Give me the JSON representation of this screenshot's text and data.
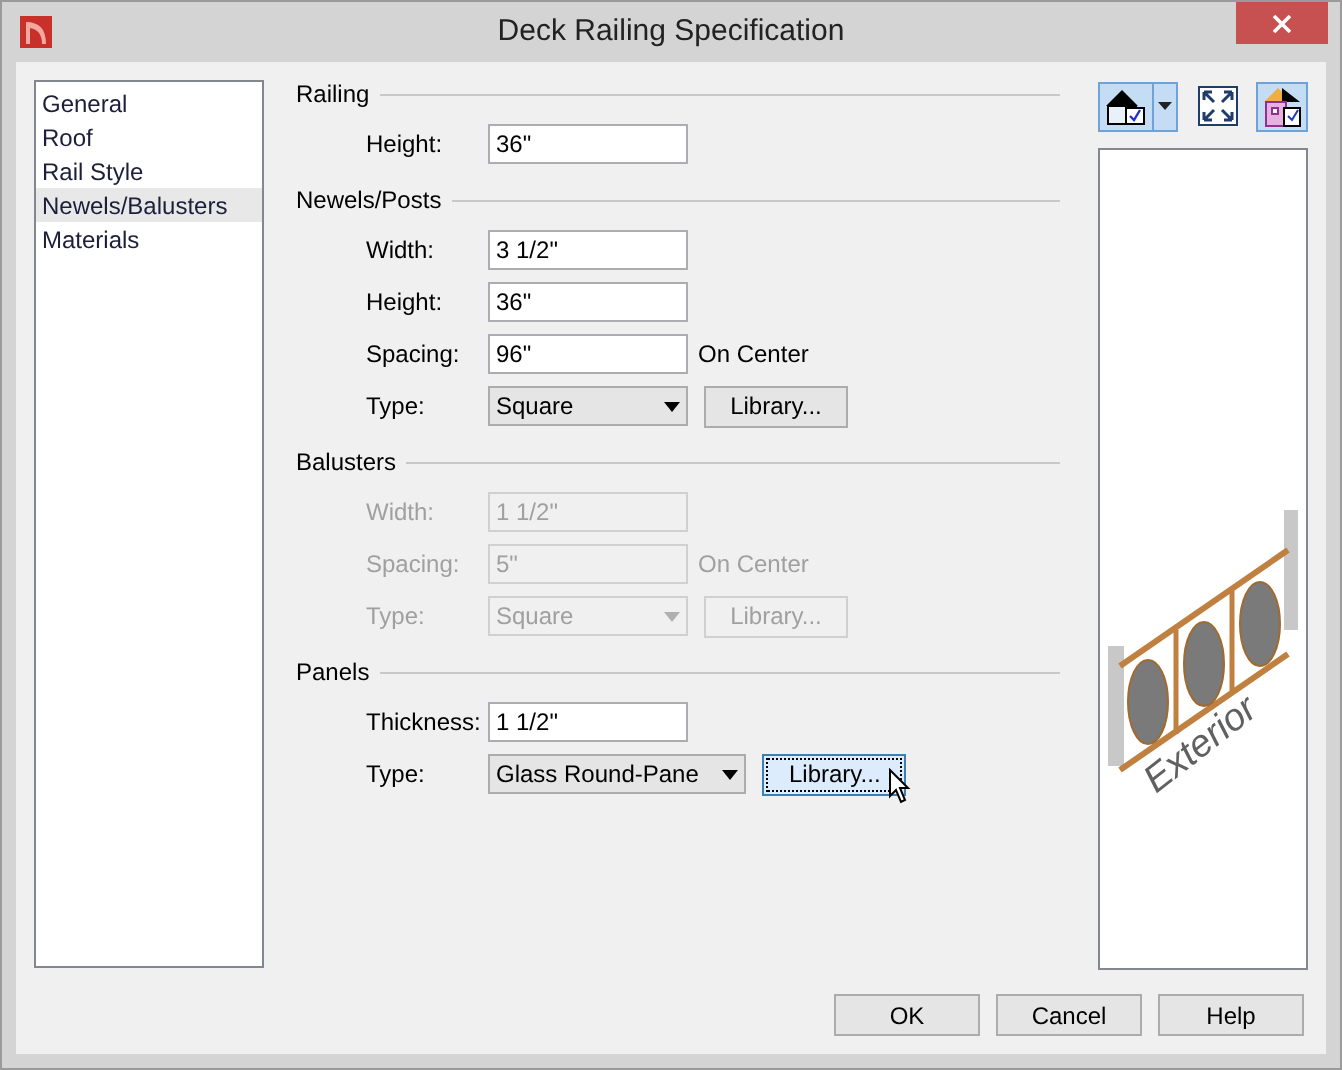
{
  "window": {
    "title": "Deck Railing Specification"
  },
  "nav": [
    {
      "label": "General",
      "selected": false
    },
    {
      "label": "Roof",
      "selected": false
    },
    {
      "label": "Rail Style",
      "selected": false
    },
    {
      "label": "Newels/Balusters",
      "selected": true
    },
    {
      "label": "Materials",
      "selected": false
    }
  ],
  "sections": [
    {
      "title": "Railing",
      "disabled": false,
      "rows": [
        {
          "kind": "field",
          "label": "Height:",
          "value": "36\""
        }
      ]
    },
    {
      "title": "Newels/Posts",
      "disabled": false,
      "rows": [
        {
          "kind": "field",
          "label": "Width:",
          "value": "3 1/2\""
        },
        {
          "kind": "field",
          "label": "Height:",
          "value": "36\""
        },
        {
          "kind": "field",
          "label": "Spacing:",
          "value": "96\"",
          "suffix": "On Center"
        },
        {
          "kind": "select",
          "label": "Type:",
          "value": "Square",
          "button": "Library...",
          "focused": false
        }
      ]
    },
    {
      "title": "Balusters",
      "disabled": true,
      "rows": [
        {
          "kind": "field",
          "label": "Width:",
          "value": "1 1/2\""
        },
        {
          "kind": "field",
          "label": "Spacing:",
          "value": "5\"",
          "suffix": "On Center"
        },
        {
          "kind": "select",
          "label": "Type:",
          "value": "Square",
          "button": "Library...",
          "focused": false
        }
      ]
    },
    {
      "title": "Panels",
      "disabled": false,
      "rows": [
        {
          "kind": "field",
          "label": "Thickness:",
          "value": "1 1/2\""
        },
        {
          "kind": "select",
          "label": "Type:",
          "value": "Glass Round-Pane",
          "button": "Library...",
          "focused": true
        }
      ]
    }
  ],
  "preview": {
    "toolbar": [
      {
        "pressed": true,
        "dropdown": true
      },
      {
        "pressed": false,
        "dropdown": false
      },
      {
        "pressed": true,
        "dropdown": false
      }
    ],
    "label": "Exterior"
  },
  "buttons": [
    "OK",
    "Cancel",
    "Help"
  ]
}
